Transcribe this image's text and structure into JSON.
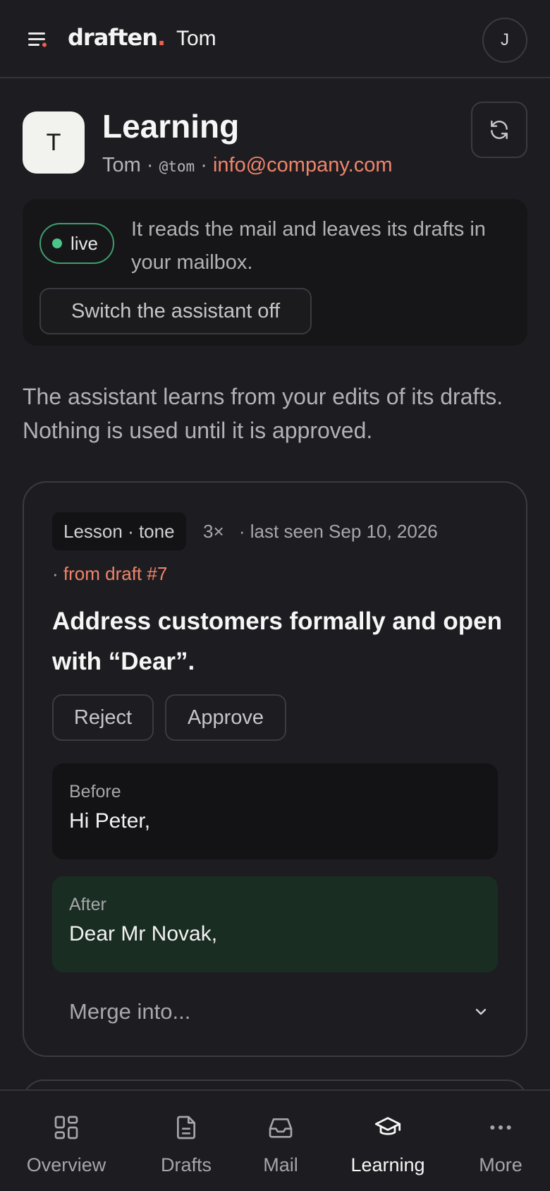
{
  "app": {
    "logo_text": "draften",
    "logo_dot": ".",
    "current_user": "Tom",
    "account_initial": "J"
  },
  "header": {
    "org_initial": "T",
    "title": "Learning",
    "name": "Tom",
    "separator": "·",
    "handle": "@tom",
    "email": "info@company.com"
  },
  "status": {
    "badge": "live",
    "description": "It reads the mail and leaves its drafts in your mailbox.",
    "toggle_label": "Switch the assistant off"
  },
  "intro": "The assistant learns from your edits of its drafts. Nothing is used until it is approved.",
  "lesson": {
    "tag": "Lesson · tone",
    "count": "3×",
    "last_seen": "· last seen Sep 10, 2026",
    "source_prefix": "·",
    "source_link": "from draft #7",
    "text": "Address customers formally and open with “Dear”.",
    "reject_label": "Reject",
    "approve_label": "Approve",
    "before_label": "Before",
    "before_value": "Hi Peter,",
    "after_label": "After",
    "after_value": "Dear Mr Novak,",
    "merge_placeholder": "Merge into..."
  },
  "nav": {
    "items": [
      {
        "label": "Overview",
        "icon": "grid-icon"
      },
      {
        "label": "Drafts",
        "icon": "document-icon"
      },
      {
        "label": "Mail",
        "icon": "inbox-icon"
      },
      {
        "label": "Learning",
        "icon": "graduation-cap-icon"
      },
      {
        "label": "More",
        "icon": "more-dots-icon"
      }
    ],
    "active": "Learning"
  },
  "colors": {
    "background": "#1d1d21",
    "accent": "#f0846b",
    "live": "#4cc48a",
    "after_bg": "#1a2d22",
    "logo_dot": "#ef5f4f"
  }
}
